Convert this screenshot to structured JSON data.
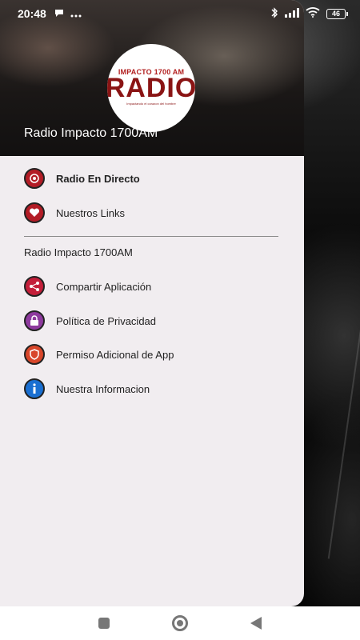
{
  "status_bar": {
    "time": "20:48",
    "battery": "46"
  },
  "drawer": {
    "logo": {
      "top_text": "IMPACTO 1700 AM",
      "main_text": "RADIO",
      "sub_text": "Impactando el corazon del hombre"
    },
    "header_title": "Radio Impacto 1700AM",
    "primary_items": [
      {
        "label": "Radio En Directo",
        "icon": "radio-icon",
        "color": "#b31c26"
      },
      {
        "label": "Nuestros Links",
        "icon": "heart-icon",
        "color": "#b31c26"
      }
    ],
    "section_title": "Radio Impacto 1700AM",
    "secondary_items": [
      {
        "label": "Compartir Aplicación",
        "icon": "share-icon",
        "color": "#c41e3a"
      },
      {
        "label": "Política de Privacidad",
        "icon": "lock-icon",
        "color": "#8e3a9e"
      },
      {
        "label": "Permiso Adicional de App",
        "icon": "shield-icon",
        "color": "#d8462a"
      },
      {
        "label": "Nuestra Informacion",
        "icon": "info-icon",
        "color": "#1a6fd1"
      }
    ]
  },
  "navbar": {
    "recents": "recents-icon",
    "home": "home-icon",
    "back": "back-icon"
  }
}
